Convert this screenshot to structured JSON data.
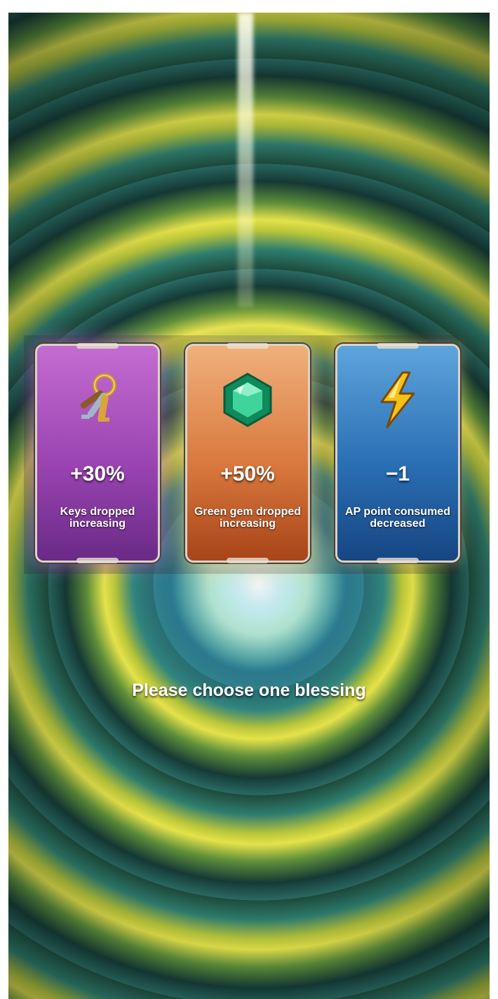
{
  "cards": [
    {
      "value": "+30%",
      "description": "Keys dropped increasing",
      "icon": "keys-icon",
      "color": "#9a44b2"
    },
    {
      "value": "+50%",
      "description": "Green gem dropped increasing",
      "icon": "green-gem-icon",
      "color": "#d9793e"
    },
    {
      "value": "−1",
      "description": "AP point consumed decreased",
      "icon": "lightning-icon",
      "color": "#2a6fb4"
    }
  ],
  "prompt": "Please choose one blessing"
}
